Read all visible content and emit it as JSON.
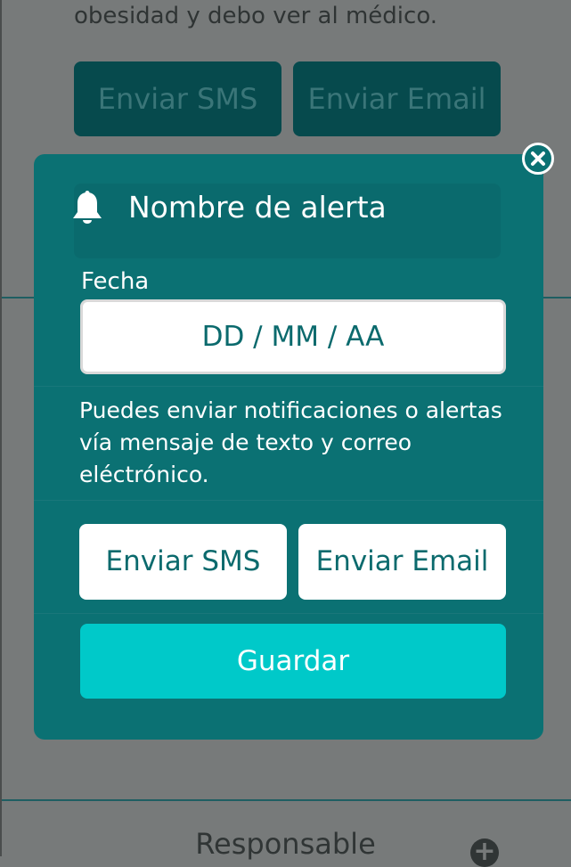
{
  "background": {
    "text": "obesidad y debo ver al médico.",
    "sms_button": "Enviar SMS",
    "email_button": "Enviar Email",
    "bottom_title": "Responsable",
    "plus_icon": "plus-circle-icon"
  },
  "modal": {
    "title": "Nombre de alerta",
    "bell_icon": "bell-icon",
    "close_icon": "close-icon",
    "date_label": "Fecha",
    "date_placeholder": "DD / MM / AA",
    "description": "Puedes enviar notificaciones o alertas vía mensaje de texto y correo eléctrónico.",
    "sms_button": "Enviar SMS",
    "email_button": "Enviar Email",
    "save_button": "Guardar"
  },
  "colors": {
    "modal_bg": "#0b7173",
    "save_button": "#00c9c9",
    "button_text": "#0b6a6d",
    "backdrop": "#777a7a"
  }
}
